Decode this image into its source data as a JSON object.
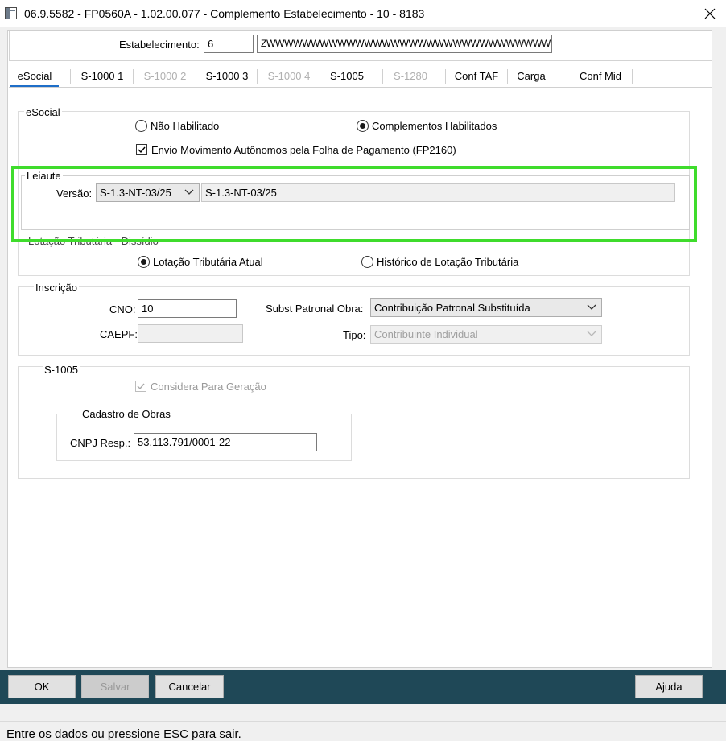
{
  "window": {
    "title": "06.9.5582 - FP0560A - 1.02.00.077 - Complemento Estabelecimento - 10 - 8183"
  },
  "header": {
    "estabelecimento_label": "Estabelecimento:",
    "estabelecimento_code": "6",
    "estabelecimento_name": "ZWWWWWWWWWWWWWWWWWWWWWWWWWWWWWWWWWW"
  },
  "tabs": [
    {
      "label": "eSocial",
      "state": "active"
    },
    {
      "label": "S-1000 1",
      "state": "enabled"
    },
    {
      "label": "S-1000 2",
      "state": "disabled"
    },
    {
      "label": "S-1000 3",
      "state": "enabled"
    },
    {
      "label": "S-1000 4",
      "state": "disabled"
    },
    {
      "label": "S-1005",
      "state": "enabled"
    },
    {
      "label": "S-1280",
      "state": "disabled"
    },
    {
      "label": "Conf TAF",
      "state": "enabled"
    },
    {
      "label": "Carga",
      "state": "enabled"
    },
    {
      "label": "Conf Mid",
      "state": "enabled"
    }
  ],
  "esocial": {
    "group_title": "eSocial",
    "radio_nao": "Não Habilitado",
    "radio_nao_checked": false,
    "radio_comp": "Complementos Habilitados",
    "radio_comp_checked": true,
    "check_envio": "Envio Movimento Autônomos pela Folha de Pagamento (FP2160)",
    "check_envio_checked": true
  },
  "leiaute": {
    "group_title": "Leiaute",
    "versao_label": "Versão:",
    "versao_selected": "S-1.3-NT-03/25",
    "versao_description": "S-1.3-NT-03/25"
  },
  "lotacao": {
    "group_title": "Lotação Tributária - Dissídio",
    "radio_atual": "Lotação Tributária Atual",
    "radio_atual_checked": true,
    "radio_historico": "Histórico de Lotação Tributária",
    "radio_historico_checked": false
  },
  "inscricao": {
    "group_title": "Inscrição",
    "cno_label": "CNO:",
    "cno_value": "10",
    "caepf_label": "CAEPF:",
    "caepf_value": "",
    "subst_label": "Subst Patronal Obra:",
    "subst_value": "Contribuição Patronal Substituída",
    "tipo_label": "Tipo:",
    "tipo_value": "Contribuinte Individual"
  },
  "s1005": {
    "group_title": "S-1005",
    "considera_label": "Considera Para Geração",
    "considera_checked": true,
    "cadastro_title": "Cadastro de Obras",
    "cnpj_label": "CNPJ Resp.:",
    "cnpj_value": "53.113.791/0001-22"
  },
  "buttons": {
    "ok": "OK",
    "salvar": "Salvar",
    "cancelar": "Cancelar",
    "ajuda": "Ajuda"
  },
  "status": {
    "text": "Entre os dados ou pressione ESC para sair."
  },
  "colors": {
    "highlight": "#3fdc2c",
    "button_bar": "#1f4857",
    "active_tab": "#1e6ec8"
  },
  "icons": {
    "window": "app-window-icon",
    "close": "close-icon",
    "dropdown": "chevron-down-icon"
  }
}
